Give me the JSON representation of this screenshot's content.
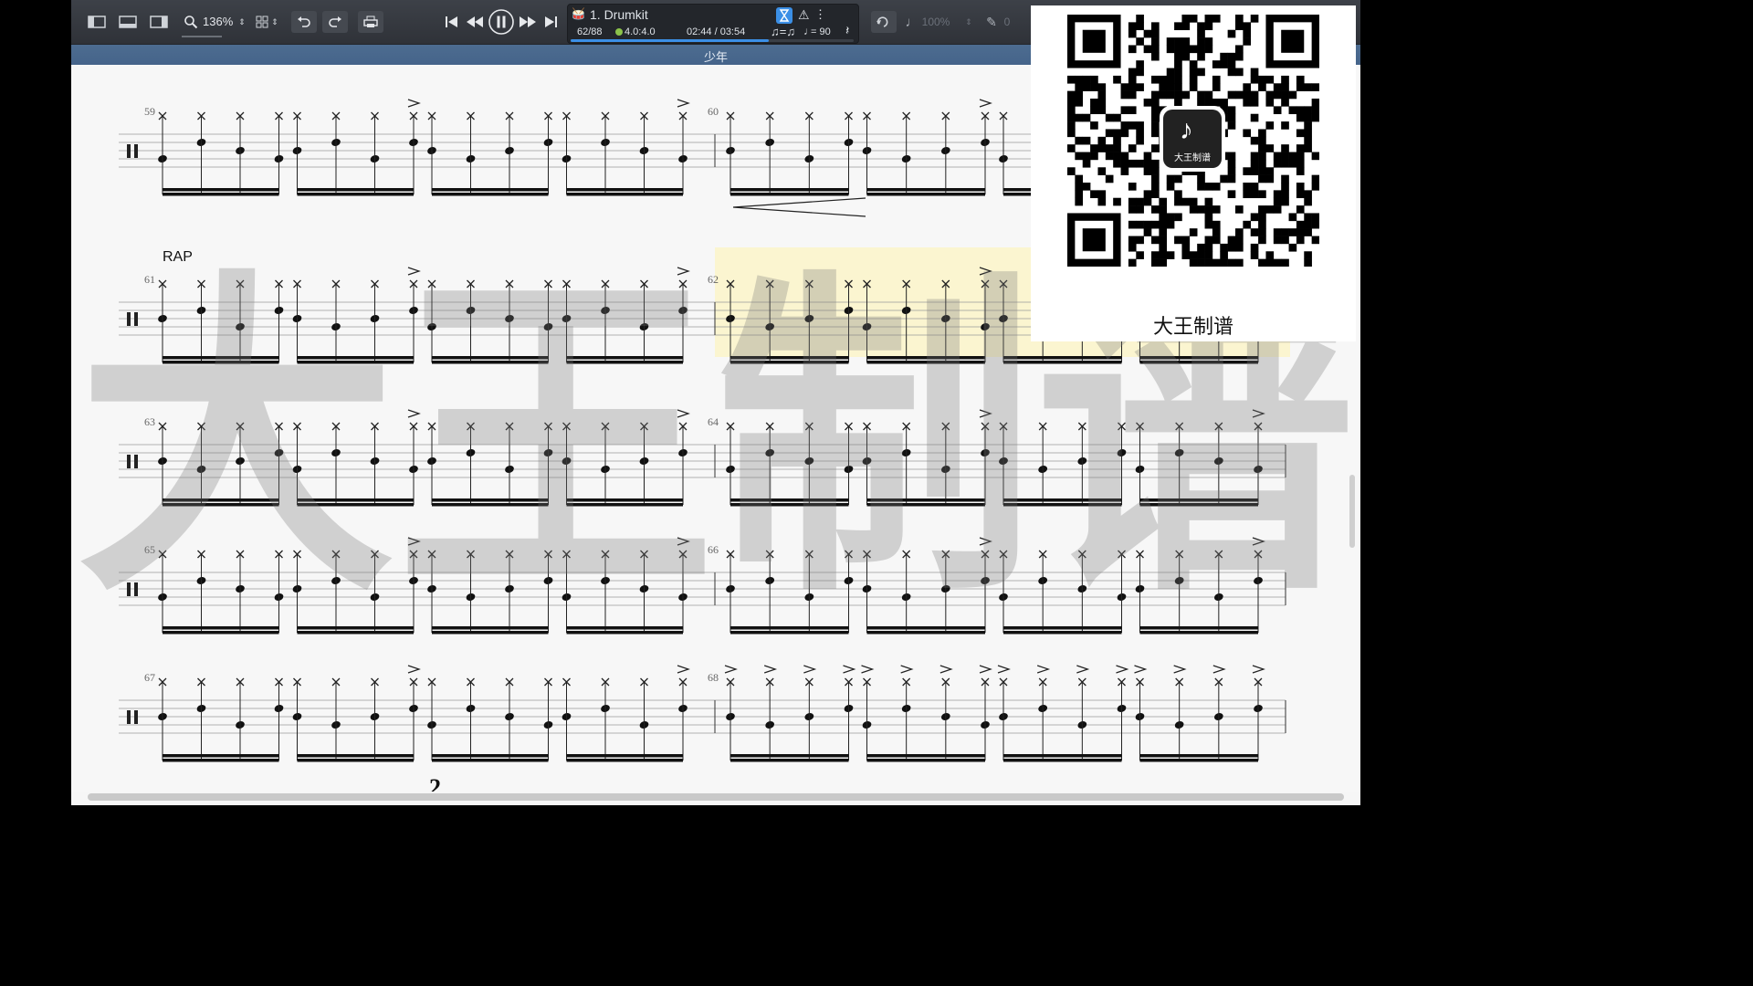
{
  "toolbar": {
    "zoom": "136%",
    "icons": [
      "sidebar-left-icon",
      "panel-bottom-icon",
      "sidebar-right-icon",
      "zoom-icon",
      "layout-grid-icon",
      "undo-icon",
      "redo-icon",
      "print-icon"
    ]
  },
  "transport": {
    "icons": [
      "skip-back-icon",
      "rewind-icon",
      "pause-icon",
      "fast-forward-icon",
      "skip-forward-icon"
    ]
  },
  "lcd": {
    "track_name": "1. Drumkit",
    "bar_position": "62/88",
    "time_signature": "4.0:4.0",
    "time": "02:44 / 03:54",
    "tempo": "= 90",
    "progress": 0.7
  },
  "right_tools": {
    "volume": "100%",
    "counter": "0"
  },
  "song_title": "少年",
  "score": {
    "measure_numbers": [
      "59",
      "60",
      "61",
      "62",
      "63",
      "64",
      "65",
      "66",
      "67",
      "68"
    ],
    "section_label": "RAP",
    "page_number": "2"
  },
  "watermark": {
    "text": "大王制谱",
    "qr_caption": "大王制谱",
    "qr_logo_text": "大王制谱"
  },
  "colors": {
    "toolbar": "#33363c",
    "accent": "#3b8fe6",
    "subtitle_bar": "#4a6a8e",
    "highlight": "#fff4b0"
  }
}
